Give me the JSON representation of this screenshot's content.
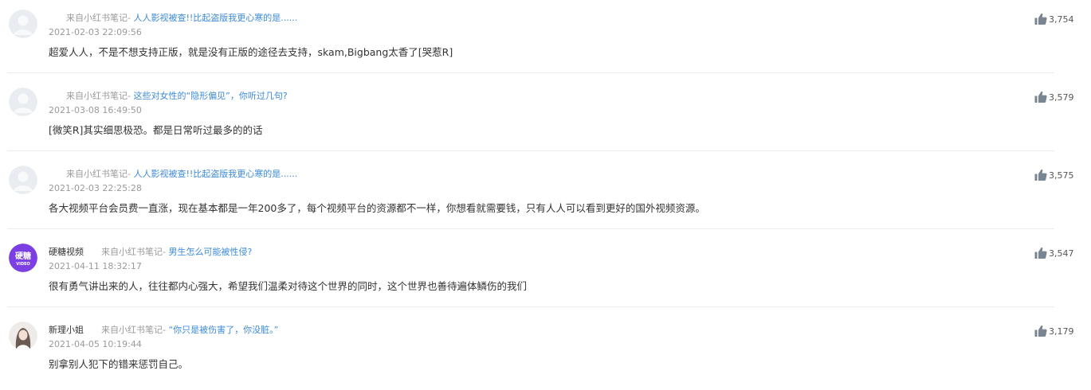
{
  "comments": [
    {
      "username": "",
      "source_label": "来自小红书笔记-",
      "note_title": "人人影视被查!!比起盗版我更心寒的是......",
      "time": "2021-02-03 22:09:56",
      "text": "超爱人人，不是不想支持正版，就是没有正版的途径去支持，skam,Bigbang太香了[哭惹R]",
      "likes": "3,754",
      "avatar": "default-avatar"
    },
    {
      "username": "",
      "source_label": "来自小红书笔记-",
      "note_title": "这些对女性的“隐形偏见”，你听过几句?",
      "time": "2021-03-08 16:49:50",
      "text": "[微笑R]其实细思极恐。都是日常听过最多的的话",
      "likes": "3,579",
      "avatar": "default-avatar"
    },
    {
      "username": "",
      "source_label": "来自小红书笔记-",
      "note_title": "人人影视被查!!比起盗版我更心寒的是......",
      "time": "2021-02-03 22:25:28",
      "text": "各大视频平台会员费一直涨，现在基本都是一年200多了，每个视频平台的资源都不一样，你想看就需要钱，只有人人可以看到更好的国外视频资源。",
      "likes": "3,575",
      "avatar": "default-avatar"
    },
    {
      "username": "硬糖视频",
      "source_label": "来自小红书笔记-",
      "note_title": "男生怎么可能被性侵?",
      "time": "2021-04-11 18:32:17",
      "text": "很有勇气讲出来的人，往往都内心强大，希望我们温柔对待这个世界的同时，这个世界也善待遍体鳞伤的我们",
      "likes": "3,547",
      "avatar": "yingtang-logo",
      "avatar_text_top": "硬糖",
      "avatar_text_bottom": "VIDEO",
      "avatar_color": "#7b3fe4"
    },
    {
      "username": "新理小姐",
      "source_label": "来自小红书笔记-",
      "note_title": "“你只是被伤害了，你没脏。”",
      "time": "2021-04-05 10:19:44",
      "text": "别拿别人犯下的错来惩罚自己。",
      "likes": "3,179",
      "avatar": "photo-avatar"
    }
  ],
  "colors": {
    "link": "#3d8bd8",
    "meta": "#9a9a9a",
    "text": "#333333",
    "icon": "#7a8593",
    "avatar_placeholder": "#e9edf1"
  }
}
